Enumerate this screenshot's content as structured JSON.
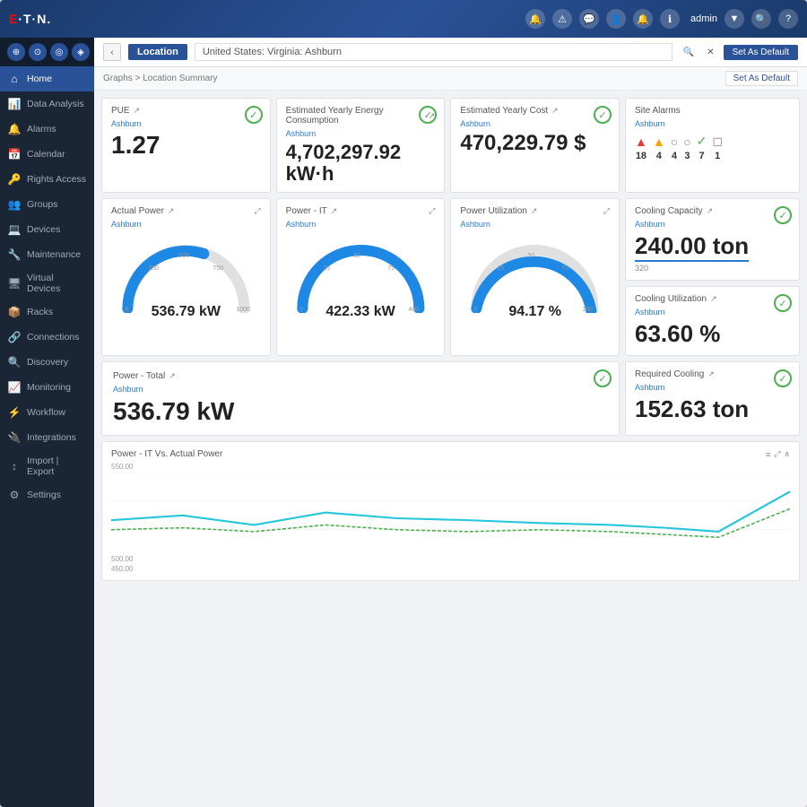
{
  "app": {
    "logo": "E·T·N.",
    "admin_label": "admin"
  },
  "topbar_icons": [
    "🔔",
    "⚠",
    "💬",
    "👤",
    "🔔",
    "ℹ"
  ],
  "sidebar": {
    "header_icons": [
      "⊕",
      "⊙",
      "◎",
      "◈"
    ],
    "items": [
      {
        "id": "home",
        "label": "Home",
        "icon": "⌂",
        "active": true
      },
      {
        "id": "data-analysis",
        "label": "Data Analysis",
        "icon": "📊"
      },
      {
        "id": "alarms",
        "label": "Alarms",
        "icon": "🔔"
      },
      {
        "id": "calendar",
        "label": "Calendar",
        "icon": "📅"
      },
      {
        "id": "rights-access",
        "label": "Rights Access",
        "icon": "🔑"
      },
      {
        "id": "groups",
        "label": "Groups",
        "icon": "👥"
      },
      {
        "id": "devices",
        "label": "Devices",
        "icon": "💻"
      },
      {
        "id": "maintenance",
        "label": "Maintenance",
        "icon": "🔧"
      },
      {
        "id": "virtual-devices",
        "label": "Virtual Devices",
        "icon": "🖥"
      },
      {
        "id": "racks",
        "label": "Racks",
        "icon": "📦"
      },
      {
        "id": "connections",
        "label": "Connections",
        "icon": "🔗"
      },
      {
        "id": "discovery",
        "label": "Discovery",
        "icon": "🔍"
      },
      {
        "id": "monitoring",
        "label": "Monitoring",
        "icon": "📈"
      },
      {
        "id": "workflow",
        "label": "Workflow",
        "icon": "⚡"
      },
      {
        "id": "integrations",
        "label": "Integrations",
        "icon": "🔌"
      },
      {
        "id": "import-export",
        "label": "Import | Export",
        "icon": "↕"
      },
      {
        "id": "settings",
        "label": "Settings",
        "icon": "⚙"
      }
    ]
  },
  "location_bar": {
    "location_label": "Location",
    "location_value": "United States: Virginia: Ashburn",
    "set_default": "Set As Default"
  },
  "breadcrumb": {
    "path": "Graphs > Location Summary",
    "set_default": "Set As Default"
  },
  "metrics": {
    "pue": {
      "title": "PUE",
      "subtitle": "Ashburn",
      "value": "1.27"
    },
    "yearly_energy": {
      "title": "Estimated Yearly Energy Consumption",
      "subtitle": "Ashburn",
      "value": "4,702,297.92 kW·h"
    },
    "yearly_cost": {
      "title": "Estimated Yearly Cost",
      "subtitle": "Ashburn",
      "value": "470,229.79 $"
    },
    "site_alarms": {
      "title": "Site Alarms",
      "subtitle": "Ashburn",
      "alarms": [
        {
          "color": "#e53935",
          "icon": "▲",
          "count": "18"
        },
        {
          "color": "#ffa000",
          "icon": "▲",
          "count": "4"
        },
        {
          "color": "#888",
          "icon": "○",
          "count": "4"
        },
        {
          "color": "#888",
          "icon": "○",
          "count": "3"
        },
        {
          "color": "#4caf50",
          "icon": "✓",
          "count": "7"
        },
        {
          "color": "#888",
          "icon": "◻",
          "count": "1"
        }
      ]
    },
    "actual_power": {
      "title": "Actual Power",
      "subtitle": "Ashburn",
      "value": "536.79 kW",
      "gauge_min": "0",
      "gauge_max": "1000",
      "gauge_marks": [
        "250",
        "500",
        "750"
      ],
      "gauge_percent": 53.679
    },
    "power_it": {
      "title": "Power - IT",
      "subtitle": "Ashburn",
      "value": "422.33 kW",
      "gauge_min": "0",
      "gauge_max": "400",
      "gauge_marks": [
        "25",
        "50",
        "75"
      ],
      "gauge_percent": 105
    },
    "power_utilization": {
      "title": "Power Utilization",
      "subtitle": "Ashburn",
      "value": "94.17 %",
      "gauge_min": "0",
      "gauge_max": "100",
      "gauge_marks": [
        "25",
        "50",
        "75"
      ],
      "gauge_percent": 94.17
    },
    "cooling_capacity": {
      "title": "Cooling Capacity",
      "subtitle": "Ashburn",
      "value": "240.00 ton",
      "sub_value": "320"
    },
    "cooling_utilization": {
      "title": "Cooling Utilization",
      "subtitle": "Ashburn",
      "value": "63.60 %"
    },
    "power_total": {
      "title": "Power - Total",
      "subtitle": "Ashburn",
      "value": "536.79 kW"
    },
    "required_cooling": {
      "title": "Required Cooling",
      "subtitle": "Ashburn",
      "value": "152.63 ton"
    }
  },
  "chart": {
    "title": "Power - IT Vs. Actual Power",
    "y_labels": [
      "550.00",
      "500.00",
      "450.00"
    ],
    "line1_color": "#26c6da",
    "line2_color": "#4caf50"
  }
}
